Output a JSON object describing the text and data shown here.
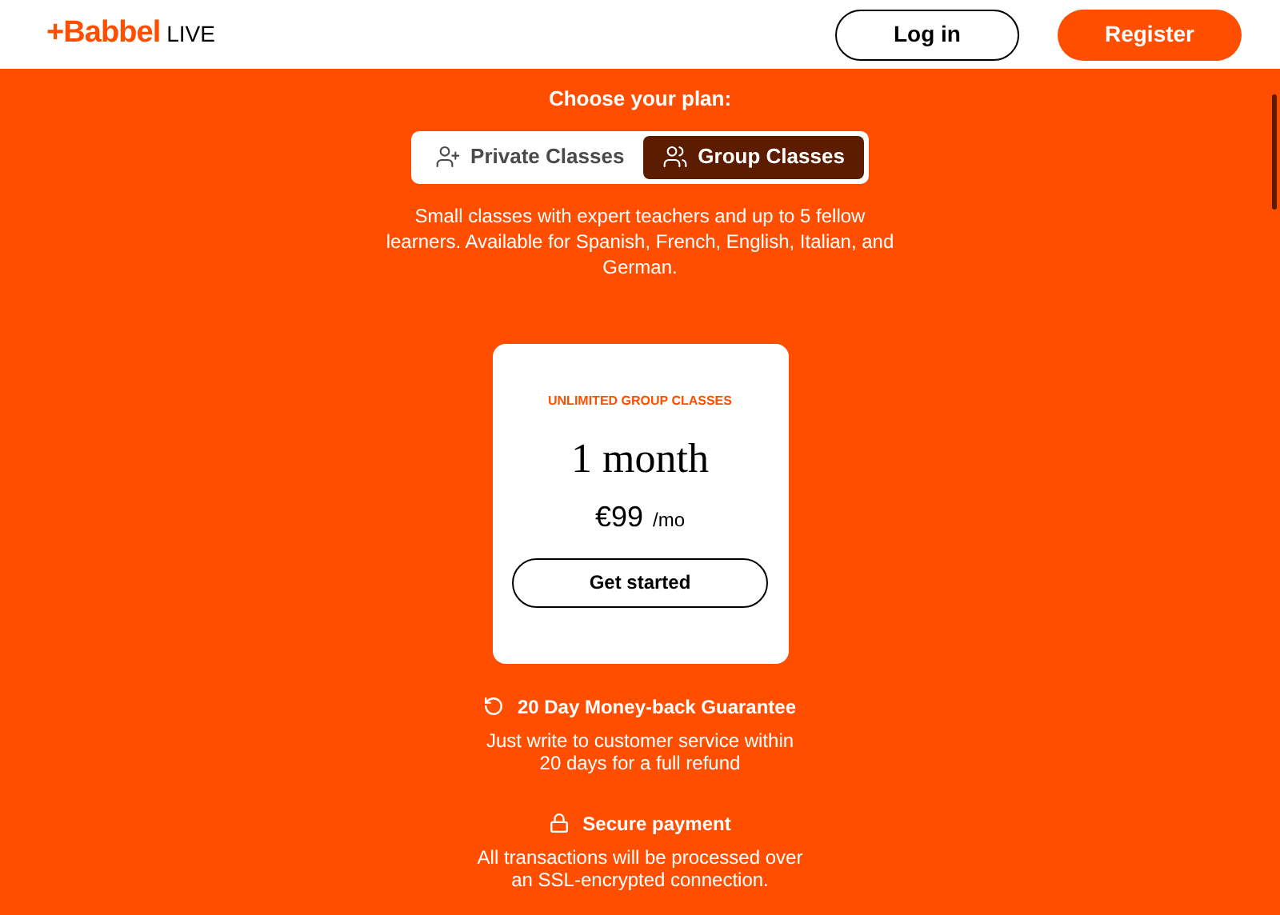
{
  "header": {
    "logo": {
      "brand": "+Babbel",
      "suffix": "LIVE"
    },
    "buttons": [
      {
        "label": "Log in",
        "kind": "outline"
      },
      {
        "label": "Register",
        "kind": "filled"
      }
    ]
  },
  "plan_picker": {
    "title": "Choose your plan:",
    "tabs": [
      {
        "label": "Private Classes",
        "kind": "private",
        "selected": false
      },
      {
        "label": "Group Classes",
        "kind": "group",
        "selected": true
      }
    ],
    "description": "Small classes with expert teachers and up to 5 fellow learners. Available for Spanish, French, English, Italian, and German."
  },
  "plan_card": {
    "eyebrow": "UNLIMITED GROUP CLASSES",
    "duration": "1 month",
    "price": "€99",
    "period": "/mo",
    "button": "Get started"
  },
  "features": [
    {
      "kind": "refund",
      "title": "20 Day Money-back Guarantee",
      "text": "Just write to customer service within 20 days for a full refund"
    },
    {
      "kind": "secure",
      "title": "Secure payment",
      "text": "All transactions will be processed over an SSL-encrypted connection."
    }
  ]
}
